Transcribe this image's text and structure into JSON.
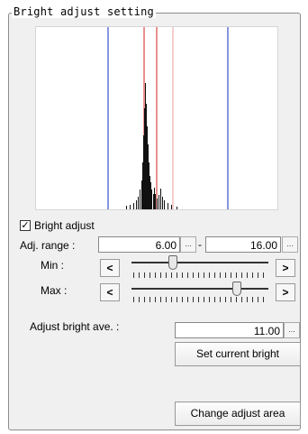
{
  "group_title": "Bright adjust setting",
  "histogram": {
    "markers": [
      {
        "kind": "blue",
        "color": "#3a4fc8",
        "pos": 0.3
      },
      {
        "kind": "red",
        "color": "#d42020",
        "pos": 0.45
      },
      {
        "kind": "red",
        "color": "#d42020",
        "pos": 0.5
      },
      {
        "kind": "pink",
        "color": "#e7a0a0",
        "pos": 0.57
      },
      {
        "kind": "blue",
        "color": "#3a4fc8",
        "pos": 0.8
      }
    ]
  },
  "bright_adjust": {
    "label": "Bright adjust",
    "checked": true,
    "check_mark": "☑"
  },
  "adj_range": {
    "label": "Adj. range :",
    "min_value": "6.00",
    "separator": "-",
    "max_value": "16.00",
    "ellipsis": "..."
  },
  "min_slider": {
    "label": "Min :",
    "left_arrow": "<",
    "right_arrow": ">",
    "level": 0.3
  },
  "max_slider": {
    "label": "Max :",
    "left_arrow": "<",
    "right_arrow": ">",
    "level": 0.78
  },
  "adjust_bright_ave": {
    "label": "Adjust bright ave. :",
    "value": "11.00",
    "ellipsis": "..."
  },
  "set_current_bright_button": "Set current bright",
  "change_adjust_area_button": "Change adjust area"
}
